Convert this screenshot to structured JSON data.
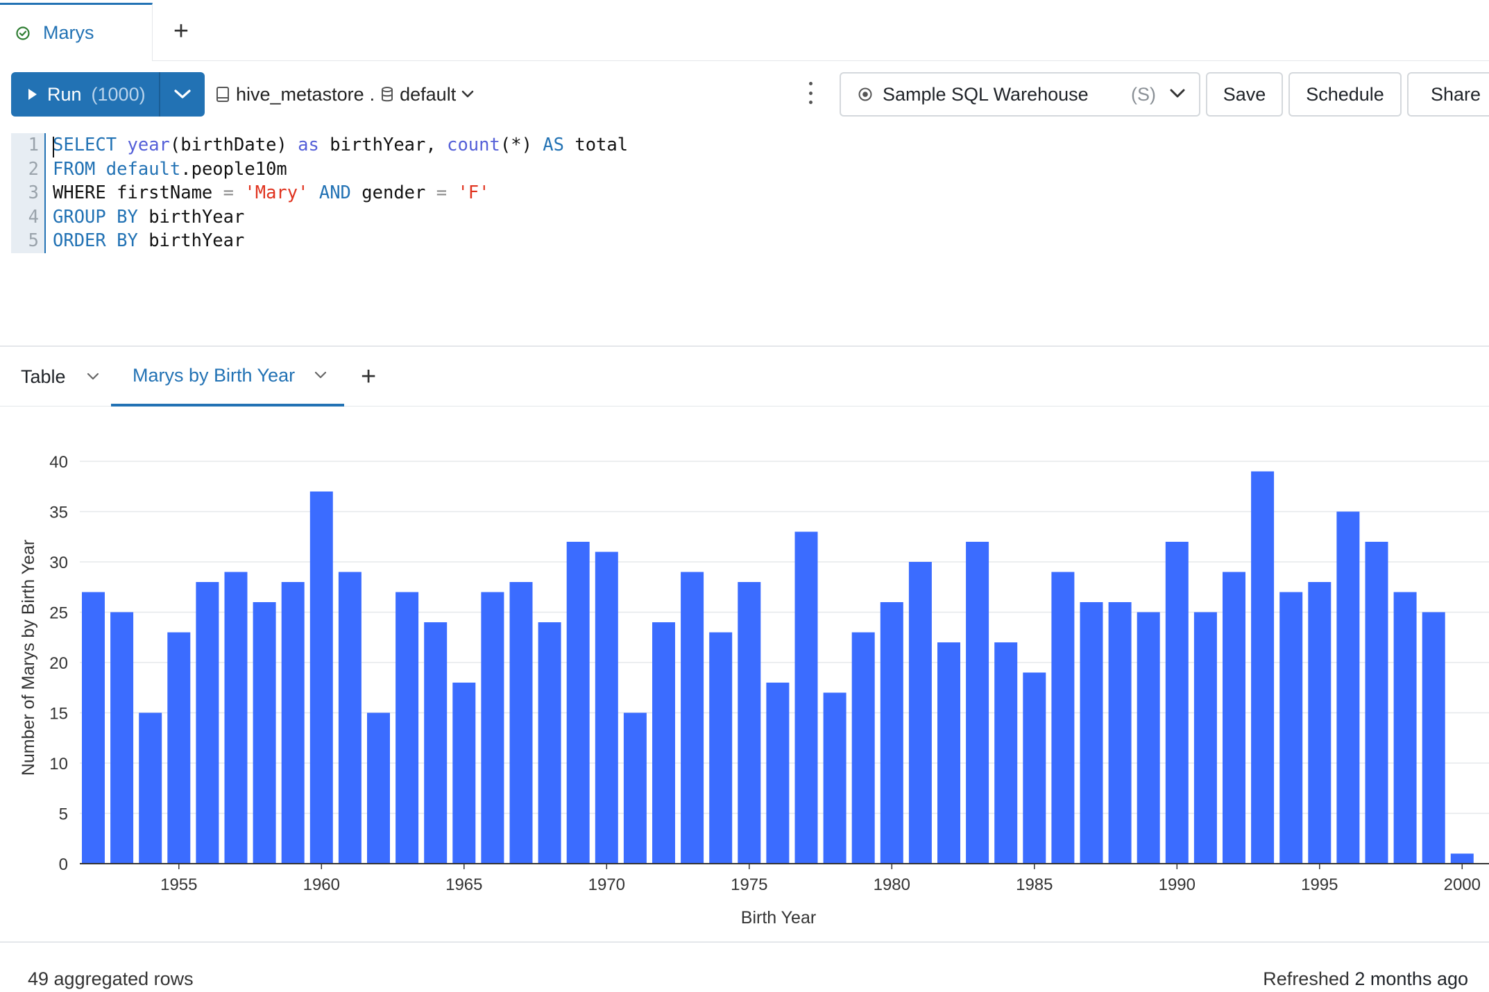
{
  "tabs": {
    "query_tab": "Marys",
    "add": "+"
  },
  "toolbar": {
    "run_label": "Run",
    "run_limit": "(1000)",
    "catalog": "hive_metastore",
    "catalog_sep": ".",
    "schema": "default",
    "warehouse_name": "Sample SQL Warehouse",
    "warehouse_size": "(S)",
    "save": "Save",
    "schedule": "Schedule",
    "share": "Share"
  },
  "editor": {
    "line_numbers": [
      "1",
      "2",
      "3",
      "4",
      "5"
    ],
    "lines": [
      [
        [
          "kw",
          "SELECT"
        ],
        [
          "t",
          " "
        ],
        [
          "fn",
          "year"
        ],
        [
          "t",
          "(birthDate) "
        ],
        [
          "fn",
          "as"
        ],
        [
          "t",
          " birthYear, "
        ],
        [
          "fn",
          "count"
        ],
        [
          "t",
          "(*) "
        ],
        [
          "kw",
          "AS"
        ],
        [
          "t",
          " total"
        ]
      ],
      [
        [
          "kw",
          "FROM"
        ],
        [
          "t",
          " "
        ],
        [
          "kw",
          "default"
        ],
        [
          "t",
          ".people10m"
        ]
      ],
      [
        [
          "t",
          "WHERE firstName "
        ],
        [
          "op",
          "="
        ],
        [
          "t",
          " "
        ],
        [
          "str",
          "'Mary'"
        ],
        [
          "t",
          " "
        ],
        [
          "kw",
          "AND"
        ],
        [
          "t",
          " gender "
        ],
        [
          "op",
          "="
        ],
        [
          "t",
          " "
        ],
        [
          "str",
          "'F'"
        ]
      ],
      [
        [
          "kw",
          "GROUP"
        ],
        [
          "t",
          " "
        ],
        [
          "kw",
          "BY"
        ],
        [
          "t",
          " birthYear"
        ]
      ],
      [
        [
          "kw",
          "ORDER"
        ],
        [
          "t",
          " "
        ],
        [
          "kw",
          "BY"
        ],
        [
          "t",
          " birthYear"
        ]
      ]
    ]
  },
  "results_tabs": {
    "table": "Table",
    "viz": "Marys by Birth Year",
    "add": "+"
  },
  "chart_data": {
    "type": "bar",
    "x": [
      1952,
      1953,
      1954,
      1955,
      1956,
      1957,
      1958,
      1959,
      1960,
      1961,
      1962,
      1963,
      1964,
      1965,
      1966,
      1967,
      1968,
      1969,
      1970,
      1971,
      1972,
      1973,
      1974,
      1975,
      1976,
      1977,
      1978,
      1979,
      1980,
      1981,
      1982,
      1983,
      1984,
      1985,
      1986,
      1987,
      1988,
      1989,
      1990,
      1991,
      1992,
      1993,
      1994,
      1995,
      1996,
      1997,
      1998,
      1999,
      2000
    ],
    "values": [
      27,
      25,
      15,
      23,
      28,
      29,
      26,
      28,
      37,
      29,
      15,
      27,
      24,
      18,
      27,
      28,
      24,
      32,
      31,
      15,
      24,
      29,
      23,
      28,
      18,
      33,
      17,
      23,
      26,
      30,
      22,
      32,
      22,
      19,
      29,
      26,
      26,
      25,
      32,
      25,
      29,
      39,
      27,
      28,
      35,
      32,
      27,
      25,
      1
    ],
    "xlabel": "Birth Year",
    "ylabel": "Number of Marys by Birth Year",
    "x_ticks": [
      "1955",
      "1960",
      "1965",
      "1970",
      "1975",
      "1980",
      "1985",
      "1990",
      "1995",
      "2000"
    ],
    "y_ticks": [
      "0",
      "5",
      "10",
      "15",
      "20",
      "25",
      "30",
      "35",
      "40"
    ],
    "ylim": [
      0,
      40
    ],
    "grid": true,
    "bar_color": "#3b6cff"
  },
  "footer": {
    "rows": "49 aggregated rows",
    "refreshed_prefix": "Refreshed",
    "refreshed_value": "2 months ago"
  }
}
